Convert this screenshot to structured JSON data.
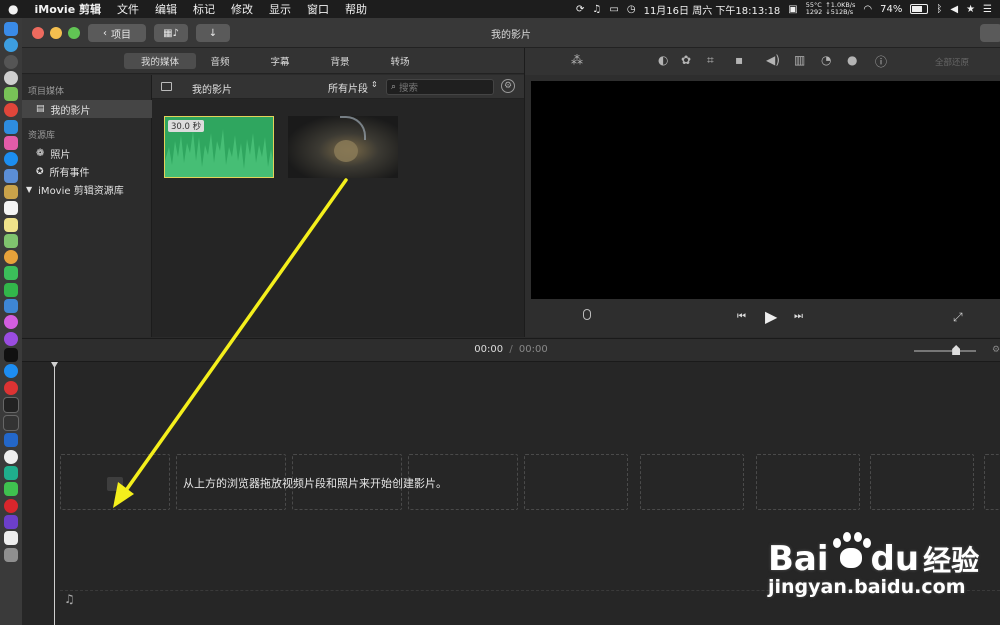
{
  "menubar": {
    "apple_icon": "apple-icon",
    "app_name": "iMovie 剪辑",
    "menus": [
      "文件",
      "编辑",
      "标记",
      "修改",
      "显示",
      "窗口",
      "帮助"
    ],
    "stats_temp": "55°C",
    "stats_up": "↑1.0KB/s",
    "stats_num": "1292",
    "stats_down": "↓512B/s",
    "datetime": "11月16日 周六 下午18:13:18",
    "battery": "74%"
  },
  "window": {
    "title": "我的影片",
    "back_label": "项目",
    "restore_label": "全部还原"
  },
  "tabs": [
    {
      "label": "我的媒体",
      "active": true
    },
    {
      "label": "音频",
      "active": false
    },
    {
      "label": "字幕",
      "active": false
    },
    {
      "label": "背景",
      "active": false
    },
    {
      "label": "转场",
      "active": false
    }
  ],
  "sidebar": {
    "section1": "项目媒体",
    "project_item": "我的影片",
    "section2": "资源库",
    "items": [
      "照片",
      "所有事件"
    ],
    "library": "iMovie 剪辑资源库"
  },
  "browser": {
    "title": "我的影片",
    "filter": "所有片段",
    "search_placeholder": "搜索",
    "clips": [
      {
        "kind": "audio",
        "duration": "30.0 秒"
      },
      {
        "kind": "video",
        "duration": ""
      }
    ]
  },
  "timeline": {
    "current_time": "00:00",
    "separator": "/",
    "total_time": "00:00",
    "zoom_level": 0.68,
    "placeholder": "从上方的浏览器拖放视频片段和照片来开始创建影片。"
  },
  "watermark": {
    "brand": "Bai",
    "brand2": "du",
    "cn": "经验",
    "url": "jingyan.baidu.com"
  },
  "colors": {
    "audio_clip": "#2fa65f",
    "arrow": "#f4ef1c",
    "accent_bar": "#3a3a3a"
  }
}
